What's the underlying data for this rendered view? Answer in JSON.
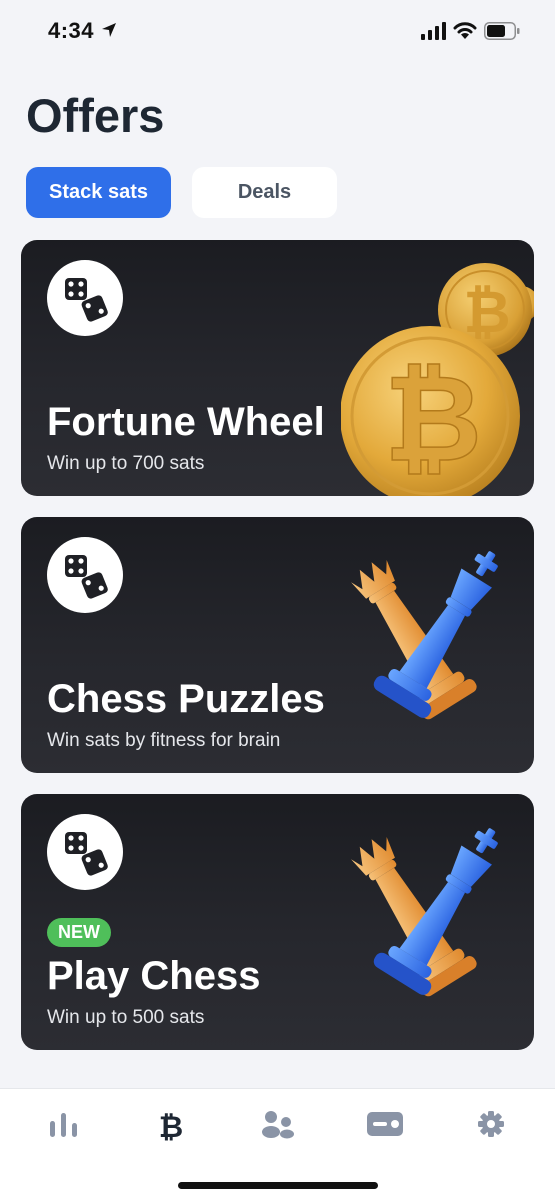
{
  "status_bar": {
    "time": "4:34",
    "icons": [
      "location-arrow-icon",
      "signal-bars-icon",
      "wifi-icon",
      "battery-icon"
    ]
  },
  "page": {
    "title": "Offers"
  },
  "segments": {
    "active_label": "Stack sats",
    "inactive_label": "Deals"
  },
  "cards": [
    {
      "title": "Fortune Wheel",
      "subtitle": "Win up to 700 sats",
      "icon": "dice-icon",
      "art": "bitcoin-coins"
    },
    {
      "title": "Chess Puzzles",
      "subtitle": "Win sats by fitness for brain",
      "icon": "dice-icon",
      "art": "chess-pieces"
    },
    {
      "title": "Play Chess",
      "subtitle": "Win up to 500 sats",
      "badge": "NEW",
      "icon": "dice-icon",
      "art": "chess-pieces"
    }
  ],
  "tabbar": {
    "tabs": [
      "stats-icon",
      "bitcoin-icon",
      "users-icon",
      "card-icon",
      "gear-icon"
    ],
    "active_index": 1
  },
  "colors": {
    "accent": "#2f6fe9",
    "badge_new": "#4fbf5a",
    "card_bg": "#1f2025",
    "tab_inactive": "#8a94a6",
    "tab_active": "#1e2733"
  }
}
